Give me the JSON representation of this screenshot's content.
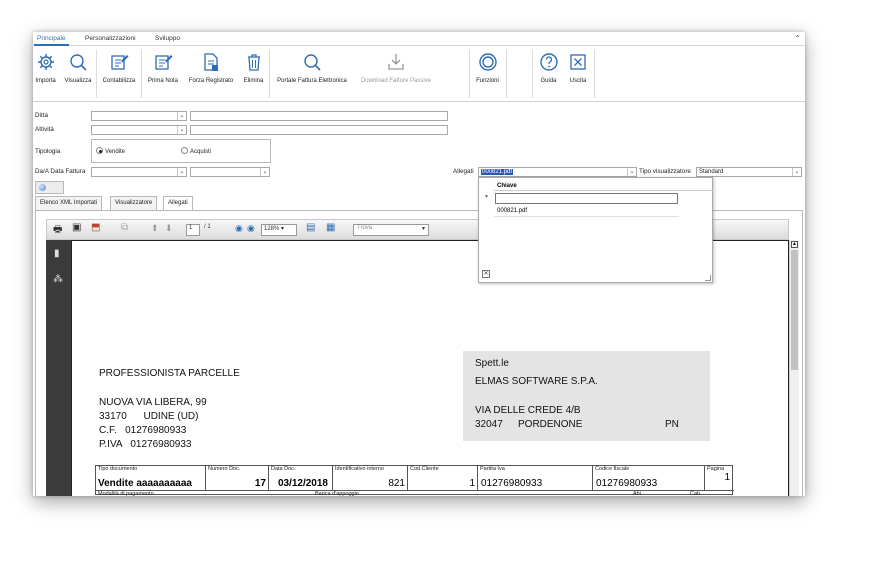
{
  "ribbon_tabs": [
    "Principale",
    "Personalizzazioni",
    "Sviluppo"
  ],
  "ribbon": {
    "buttons": [
      {
        "label": "Importa",
        "icon": "import-gear-icon"
      },
      {
        "label": "Visualizza",
        "icon": "search-icon"
      },
      {
        "label": "Contabilizza",
        "icon": "edit-document-icon"
      },
      {
        "label": "Prima Nota",
        "icon": "edit-note-icon"
      },
      {
        "label": "Forza Registrato",
        "icon": "force-register-icon"
      },
      {
        "label": "Elimina",
        "icon": "trash-icon"
      },
      {
        "label": "Portale Fattura Elettronica",
        "icon": "search-icon"
      },
      {
        "label": "Download Fatture Passive",
        "icon": "download-tray-icon"
      },
      {
        "label": "Funzioni",
        "icon": "functions-ring-icon"
      },
      {
        "label": "Guida",
        "icon": "help-icon"
      },
      {
        "label": "Uscita",
        "icon": "exit-icon"
      }
    ]
  },
  "form": {
    "ditta_label": "Ditta",
    "attivita_label": "Attività",
    "tipologia_label": "Tipologia",
    "radio_vendite": "Vendite",
    "radio_acquisti": "Acquisti",
    "data_fattura_label": "Da/A Data Fattura",
    "allegati_label": "Allegati",
    "allegati_value": "000821.pdf",
    "tipo_visualizzatore_label": "Tipo visualizzatore",
    "tipo_visualizzatore_value": "Standard"
  },
  "inner_tabs": [
    "Elenco XML Importati",
    "Visualizzatore",
    "Allegati"
  ],
  "pdf_toolbar": {
    "page_current": "1",
    "page_total": "/ 1",
    "zoom": "128%",
    "find_placeholder": "Trova"
  },
  "dropdown": {
    "column_header": "Chiave",
    "filter_marker": "▼",
    "rows": [
      "000821.pdf"
    ],
    "close_glyph": "✕"
  },
  "document": {
    "sender_name": "PROFESSIONISTA PARCELLE",
    "sender_address": "NUOVA VIA LIBERA, 99",
    "sender_city": "33170      UDINE (UD)",
    "sender_cf": "C.F.   01276980933",
    "sender_piva": "P.IVA   01276980933",
    "dest_title": "Spett.le",
    "dest_name": "ELMAS SOFTWARE S.P.A.",
    "dest_address": "VIA DELLE CREDE 4/B",
    "dest_cap": "32047",
    "dest_city": "PORDENONE",
    "dest_prov": "PN",
    "grid_headers": [
      "Tipo documento",
      "Numero Doc.",
      "Data Doc.",
      "Identificativo interno",
      "Cod.Cliente",
      "Partita Iva",
      "Codice fiscale",
      "Pagina"
    ],
    "grid_values": [
      "Vendite aaaaaaaaaa",
      "17",
      "03/12/2018",
      "821",
      "1",
      "01276980933",
      "01276980933",
      "1"
    ],
    "row2_headers": [
      "Modalità di pagamento",
      "Banca d'appoggio",
      "Abi",
      "Cab"
    ]
  }
}
